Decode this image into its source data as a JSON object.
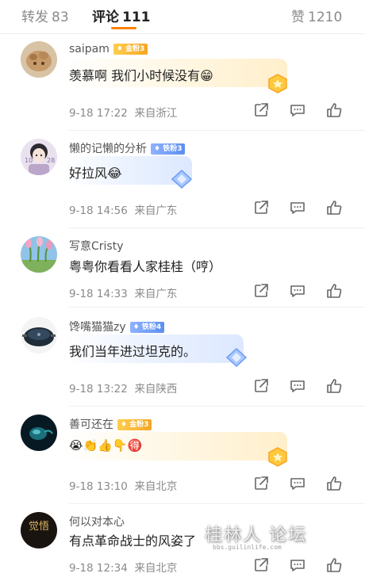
{
  "tabs": [
    {
      "label": "转发",
      "count": "83",
      "active": false
    },
    {
      "label": "评论",
      "count": "111",
      "active": true
    },
    {
      "label": "赞",
      "count": "1210",
      "active": false
    }
  ],
  "comments": [
    {
      "user": "saipam",
      "badge": "金粉3",
      "text": "羡慕啊 我们小时候没有😁",
      "time": "9-18 17:22",
      "location": "来自浙江"
    },
    {
      "user": "懒的记懒的分析",
      "badge": "铁粉3",
      "text": "好拉风😂",
      "time": "9-18 14:56",
      "location": "来自广东"
    },
    {
      "user": "写意Cristy",
      "badge": "",
      "text": "粤粤你看看人家桂桂（哼）",
      "time": "9-18 14:33",
      "location": "来自广东"
    },
    {
      "user": "馋嘴猫猫zy",
      "badge": "铁粉4",
      "text": "我们当年进过坦克的。",
      "time": "9-18 13:22",
      "location": "来自陕西"
    },
    {
      "user": "善可还在",
      "badge": "金粉3",
      "text": "😭👏👍👇🉐",
      "time": "9-18 13:10",
      "location": "来自北京"
    },
    {
      "user": "何以对本心",
      "badge": "",
      "text": "有点革命战士的风姿了",
      "time": "9-18 12:34",
      "location": "来自北京"
    }
  ],
  "avatars": {
    "c5_text": "觉悟"
  },
  "watermark": {
    "text": "桂林人 论坛",
    "sub": "bbs.guilinlife.com"
  },
  "colors": {
    "accent": "#ff8200",
    "gold_badge": "#f5a623",
    "iron_badge": "#5b8ef0"
  }
}
